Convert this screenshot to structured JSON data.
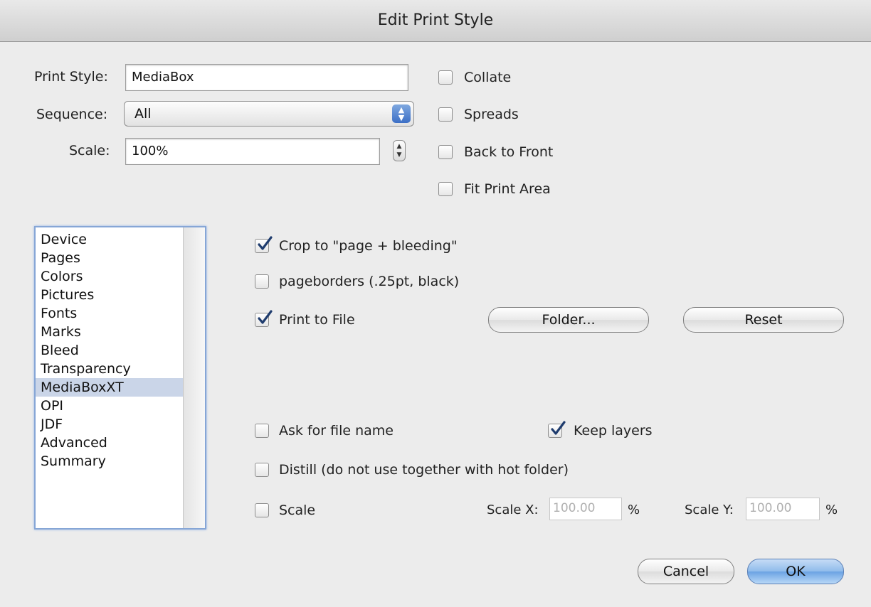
{
  "title": "Edit Print Style",
  "print_style": {
    "label": "Print Style:",
    "value": "MediaBox"
  },
  "sequence": {
    "label": "Sequence:",
    "value": "All"
  },
  "scale_top": {
    "label": "Scale:",
    "value": "100%"
  },
  "top_checkboxes": [
    {
      "label": "Collate",
      "checked": false
    },
    {
      "label": "Spreads",
      "checked": false
    },
    {
      "label": "Back to Front",
      "checked": false
    },
    {
      "label": "Fit Print Area",
      "checked": false
    }
  ],
  "sidebar": {
    "items": [
      "Device",
      "Pages",
      "Colors",
      "Pictures",
      "Fonts",
      "Marks",
      "Bleed",
      "Transparency",
      "MediaBoxXT",
      "OPI",
      "JDF",
      "Advanced",
      "Summary"
    ],
    "selected": "MediaBoxXT"
  },
  "options": {
    "crop": {
      "label": "Crop to \"page + bleeding\"",
      "checked": true
    },
    "pageborders": {
      "label": "pageborders (.25pt, black)",
      "checked": false
    },
    "print_to_file": {
      "label": "Print to File",
      "checked": true
    },
    "ask_file_name": {
      "label": "Ask for file name",
      "checked": false
    },
    "keep_layers": {
      "label": "Keep layers",
      "checked": true
    },
    "distill": {
      "label": "Distill (do not use together with hot folder)",
      "checked": false
    },
    "scale": {
      "label": "Scale",
      "checked": false
    }
  },
  "buttons": {
    "folder": "Folder...",
    "reset": "Reset",
    "cancel": "Cancel",
    "ok": "OK"
  },
  "scale_x": {
    "label": "Scale X:",
    "value": "100.00",
    "unit": "%"
  },
  "scale_y": {
    "label": "Scale Y:",
    "value": "100.00",
    "unit": "%"
  },
  "colors": {
    "accent": "#6aa2e3",
    "selection": "#cad5e8",
    "checkmark": "#1f3c6e"
  }
}
